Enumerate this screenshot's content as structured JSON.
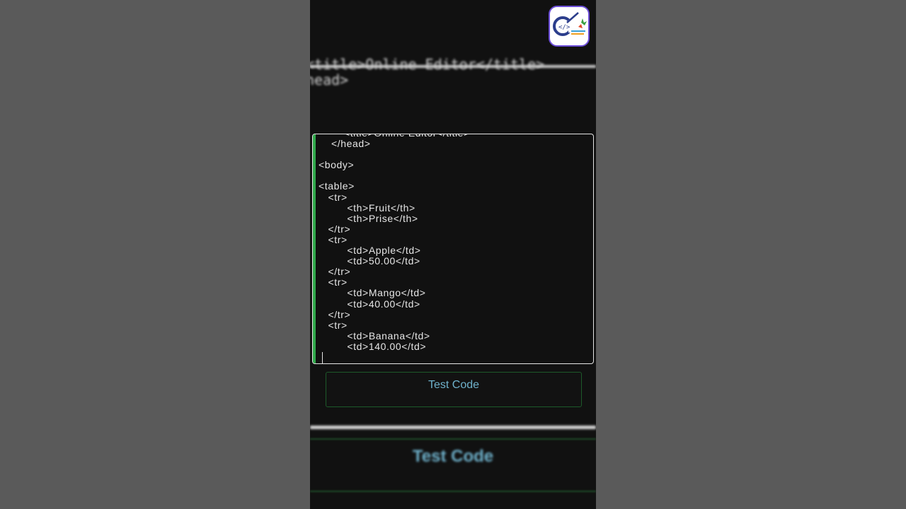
{
  "editor": {
    "lines": [
      "        <title>Online Editor</title>",
      "    </head>",
      "",
      "<body>",
      "",
      "<table>",
      "   <tr>",
      "         <th>Fruit</th>",
      "         <th>Prise</th>",
      "   </tr>",
      "   <tr>",
      "         <td>Apple</td>",
      "         <td>50.00</td>",
      "   </tr>",
      "   <tr>",
      "         <td>Mango</td>",
      "         <td>40.00</td>",
      "   </tr>",
      "   <tr>",
      "         <td>Banana</td>",
      "         <td>140.00</td>"
    ]
  },
  "blurred_top": {
    "line1": "<title>Online Editor</title>",
    "line2": "head>"
  },
  "test_button": {
    "label": "Test Code"
  },
  "blurred_bottom": {
    "label": "Test Code"
  },
  "logo": {
    "icon": "code-brand-logo-icon"
  },
  "colors": {
    "background": "#111111",
    "accent_green": "#2fa84a",
    "button_text": "#6fb2cc",
    "side_gray": "#595959"
  }
}
